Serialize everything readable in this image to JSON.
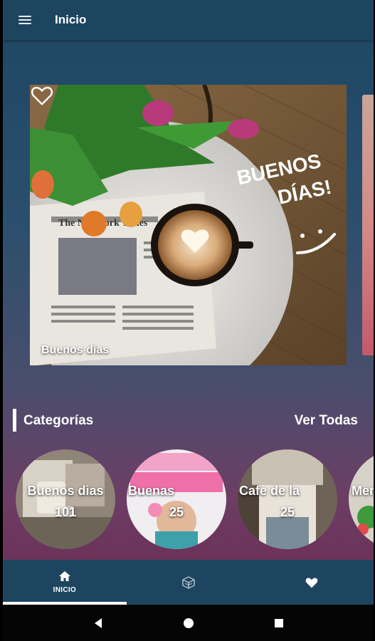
{
  "appbar": {
    "title": "Inicio",
    "menu_icon": "menu-icon"
  },
  "hero": {
    "caption": "Buenos días",
    "image_text_line1": "BUENOS",
    "image_text_line2": "DÍAS!",
    "newspaper_text": "The New York Times",
    "favorite_icon": "heart-outline-icon"
  },
  "categories_section": {
    "title": "Categorías",
    "see_all": "Ver Todas",
    "items": [
      {
        "label": "Buenos dias",
        "count": "101"
      },
      {
        "label": "Buenas",
        "count": "25"
      },
      {
        "label": "Cafe de la",
        "count": "25"
      },
      {
        "label": "Mer",
        "count": ""
      }
    ]
  },
  "bottom_nav": {
    "items": [
      {
        "label": "INICIO",
        "icon": "home-icon",
        "active": true
      },
      {
        "label": "",
        "icon": "categories-cube-icon",
        "active": false
      },
      {
        "label": "",
        "icon": "heart-icon",
        "active": false
      }
    ]
  },
  "system_nav": {
    "back": "back-icon",
    "home": "home-circle-icon",
    "recents": "recents-icon"
  },
  "colors": {
    "appbar": "#1d4560",
    "gradient_top": "#1c4763",
    "gradient_bottom": "#6b2f57",
    "text": "#ffffff"
  }
}
